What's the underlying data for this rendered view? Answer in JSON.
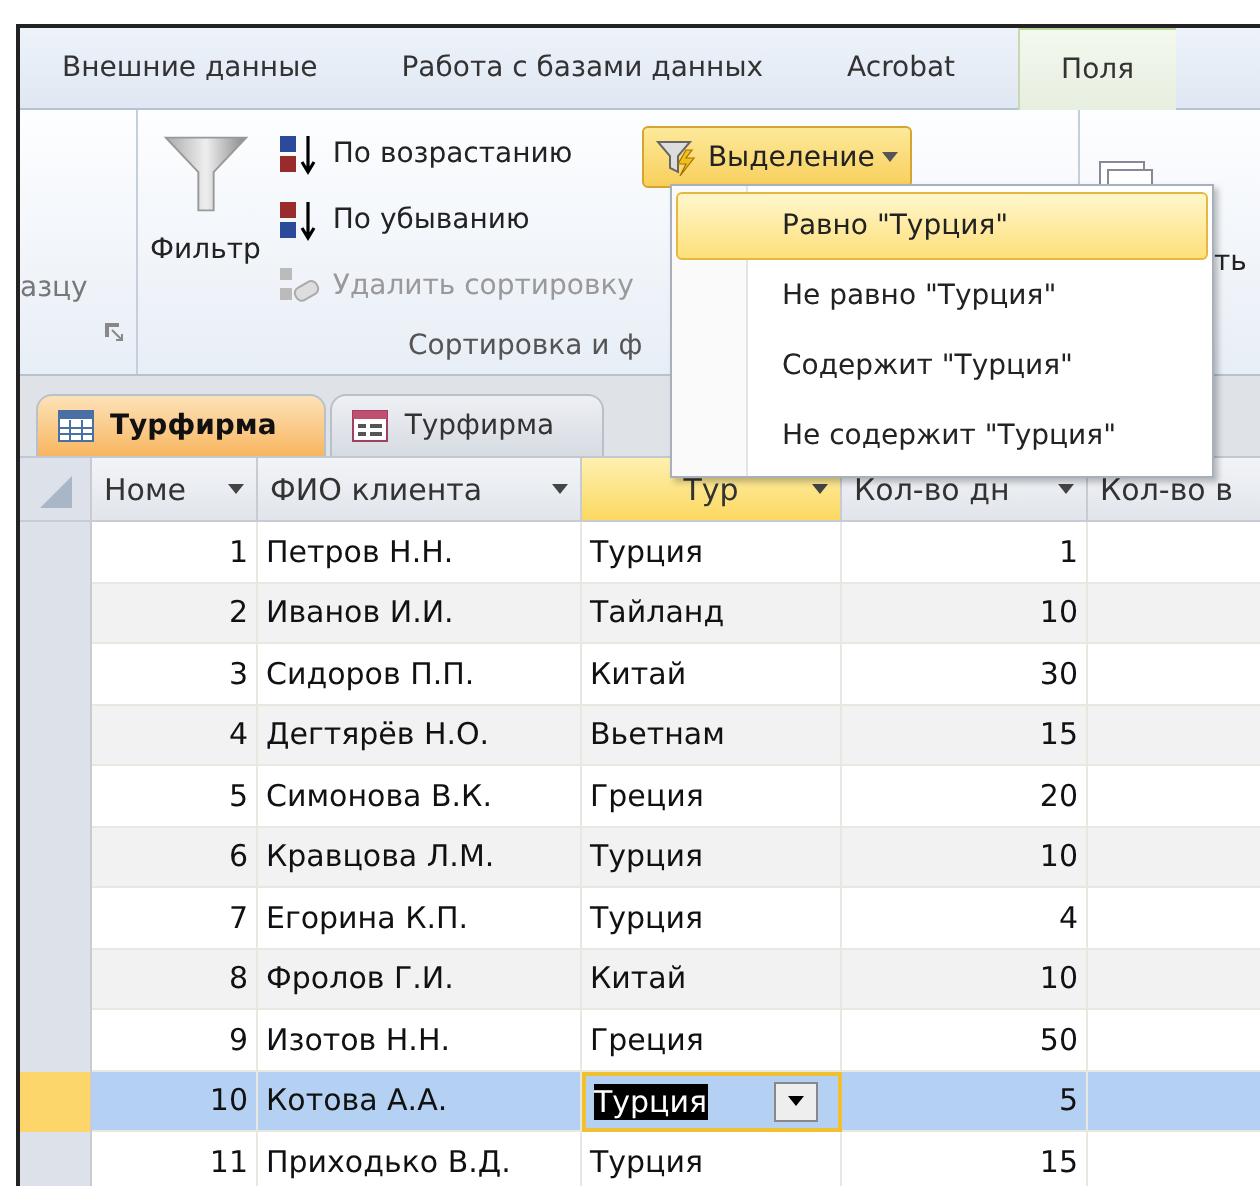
{
  "ribbon_tabs": [
    {
      "label": "Внешние данные",
      "contextual": false
    },
    {
      "label": "Работа с базами данных",
      "contextual": false
    },
    {
      "label": "Acrobat",
      "contextual": false
    },
    {
      "label": "Поля",
      "contextual": true
    }
  ],
  "ribbon": {
    "left_group_fragment": "азцу",
    "filter_button": "Фильтр",
    "sort_ascending": "По возрастанию",
    "sort_descending": "По убыванию",
    "remove_sort": {
      "label": "Удалить сортировку",
      "disabled": true
    },
    "selection_button": {
      "label": "Выделение",
      "expanded": true
    },
    "group_label": "Сортировка и ф",
    "right_fragment": "ть"
  },
  "selection_menu": {
    "items": [
      {
        "label": "Равно \"Турция\"",
        "selected": true
      },
      {
        "label": "Не равно \"Турция\"",
        "selected": false
      },
      {
        "label": "Содержит \"Турция\"",
        "selected": false
      },
      {
        "label": "Не содержит \"Турция\"",
        "selected": false
      }
    ]
  },
  "document_tabs": [
    {
      "label": "Турфирма",
      "kind": "table",
      "selected": true
    },
    {
      "label": "Турфирма",
      "kind": "form",
      "selected": false
    }
  ],
  "table": {
    "columns": [
      {
        "label": "Номе",
        "selected": false,
        "kind": "number"
      },
      {
        "label": "ФИО клиента",
        "selected": false,
        "kind": "text"
      },
      {
        "label": "Тур",
        "selected": true,
        "kind": "text"
      },
      {
        "label": "Кол-во дн",
        "selected": false,
        "kind": "number"
      },
      {
        "label": "Кол-во в",
        "selected": false,
        "kind": "text"
      }
    ],
    "rows": [
      {
        "cells": [
          "1",
          "Петров Н.Н.",
          "Турция",
          "1"
        ],
        "selected": false
      },
      {
        "cells": [
          "2",
          "Иванов И.И.",
          "Тайланд",
          "10"
        ],
        "selected": false
      },
      {
        "cells": [
          "3",
          "Сидоров П.П.",
          "Китай",
          "30"
        ],
        "selected": false
      },
      {
        "cells": [
          "4",
          "Дегтярёв Н.О.",
          "Вьетнам",
          "15"
        ],
        "selected": false
      },
      {
        "cells": [
          "5",
          "Симонова В.К.",
          "Греция",
          "20"
        ],
        "selected": false
      },
      {
        "cells": [
          "6",
          "Кравцова Л.М.",
          "Турция",
          "10"
        ],
        "selected": false
      },
      {
        "cells": [
          "7",
          "Егорина К.П.",
          "Турция",
          "4"
        ],
        "selected": false
      },
      {
        "cells": [
          "8",
          "Фролов Г.И.",
          "Китай",
          "10"
        ],
        "selected": false
      },
      {
        "cells": [
          "9",
          "Изотов Н.Н.",
          "Греция",
          "50"
        ],
        "selected": false
      },
      {
        "cells": [
          "10",
          "Котова А.А.",
          "Турция",
          "5"
        ],
        "selected": true
      },
      {
        "cells": [
          "11",
          "Приходько В.Д.",
          "Турция",
          "15"
        ],
        "selected": false
      }
    ]
  }
}
